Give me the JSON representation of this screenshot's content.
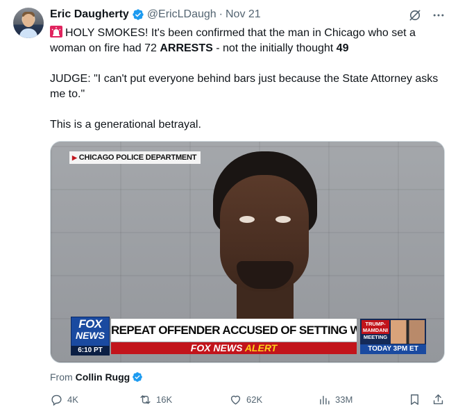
{
  "author": {
    "name": "Eric Daugherty",
    "handle": "@EricLDaugh",
    "separator": "·",
    "date": "Nov 21"
  },
  "tweet": {
    "line1_prefix": "HOLY SMOKES! It's been confirmed that the man in Chicago who set a woman on fire had 72 ",
    "line1_bold": "ARRESTS",
    "line1_mid": " - not the initially thought ",
    "line1_bold2": "49",
    "paragraph2": "JUDGE: \"I can't put everyone behind bars just because the State Attorney asks me to.\"",
    "paragraph3": "This is a generational betrayal."
  },
  "media": {
    "source_chip": "CHICAGO POLICE DEPARTMENT",
    "network_logo_top": "FOX",
    "network_logo_bottom": "NEWS",
    "network_time": "6:10 PT",
    "headline": "REPEAT OFFENDER ACCUSED OF SETTING WOMAN ON FIRE",
    "alert_part1": "FOX NEWS ",
    "alert_part2": "ALERT",
    "promo_tag": "TRUMP-MAMDANI",
    "promo_meeting": "MEETING",
    "promo_time": "TODAY 3PM ET"
  },
  "attribution": {
    "prefix": "From",
    "source": "Collin Rugg"
  },
  "stats": {
    "replies": "4K",
    "reposts": "16K",
    "likes": "62K",
    "views": "33M"
  },
  "colors": {
    "verified": "#1d9bf0",
    "muted": "#536471",
    "text": "#0f1419",
    "fox_red": "#c2141b",
    "fox_blue": "#1a4aa0"
  }
}
